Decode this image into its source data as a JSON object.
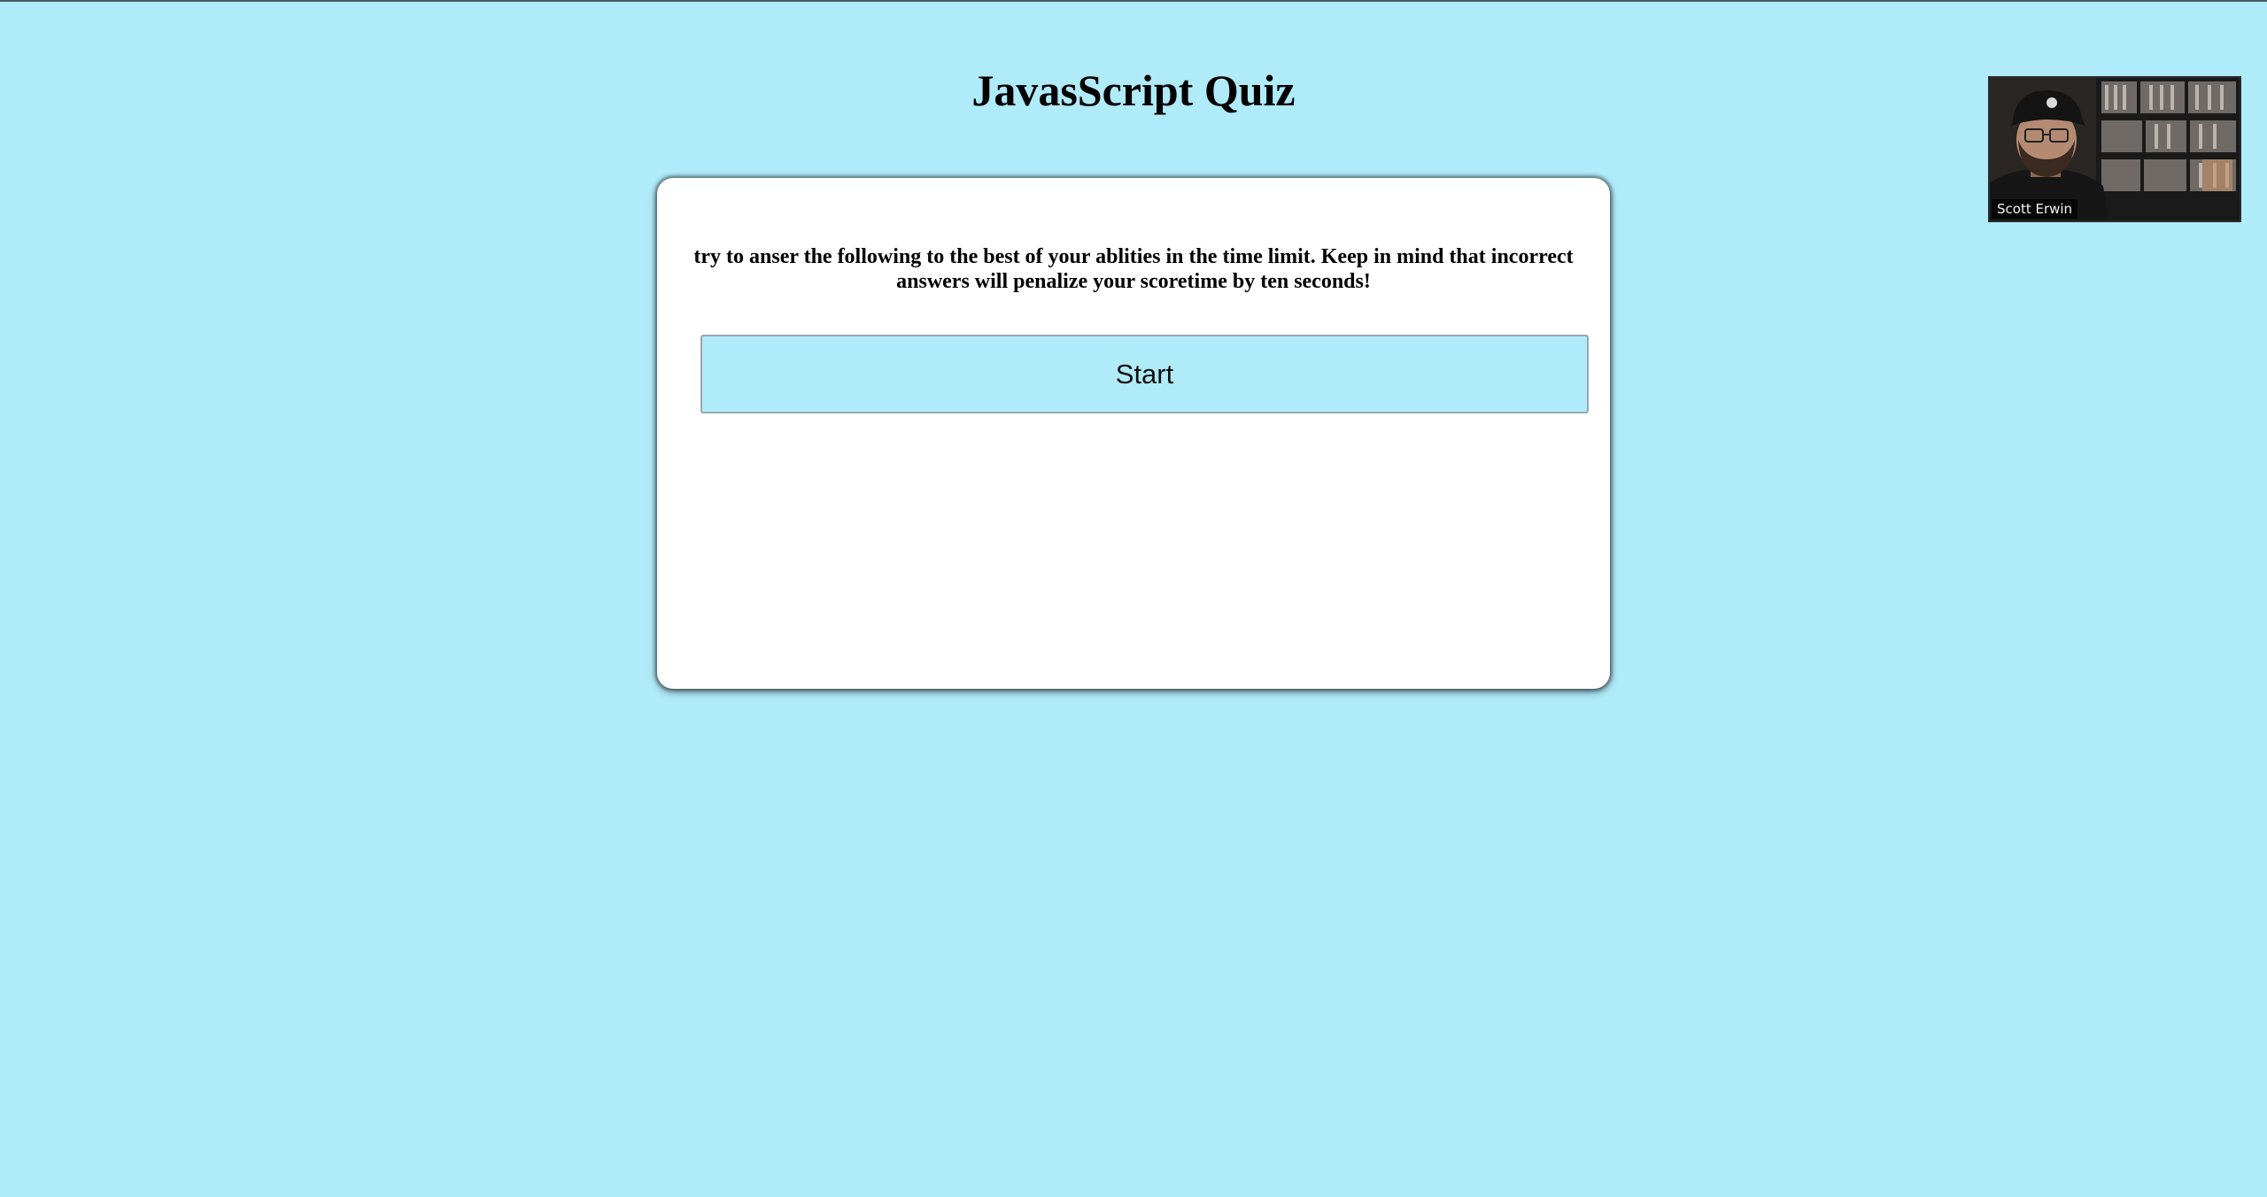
{
  "header": {
    "title": "JavasScript Quiz"
  },
  "quiz": {
    "instructions": "try to anser the following to the best of your ablities in the time limit. Keep in mind that incorrect answers will penalize your scoretime by ten seconds!",
    "start_label": "Start"
  },
  "video_call": {
    "participant_name": "Scott Erwin"
  },
  "colors": {
    "background": "#b0ebf9",
    "card": "#ffffff",
    "button": "#b0ebf9"
  }
}
